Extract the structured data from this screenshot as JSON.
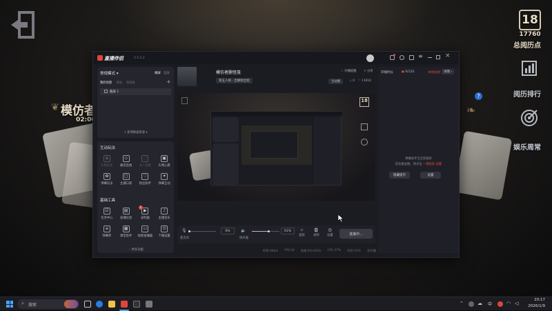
{
  "desktop": {
    "level_badge": "18",
    "points_value": "17760",
    "points_label": "总阅历点",
    "rank_label": "阅历排行",
    "weekly_label": "娱乐周常",
    "left_title": "模仿者",
    "left_timer": "02:00",
    "help_mark": "?"
  },
  "app": {
    "logo_text": "直播伴侣",
    "version": "5.5.5.2",
    "mode_label": "常规模式",
    "mode_tab_landscape": "横屏",
    "mode_tab_portrait": "竖屏",
    "scene_tabs": [
      "我的场景",
      "添加",
      "添加收"
    ],
    "scene_item": "截屏 1",
    "add_source_label": "新增数据来源",
    "interactive_title": "互动玩法",
    "interactive_items": [
      "礼物玩法",
      "嘉宾连线",
      "多人连麦",
      "礼物心愿",
      "弹幕玩法",
      "主播口袋",
      "粉丝助手",
      "弹幕互动"
    ],
    "tools_title": "基础工具",
    "tools_items": [
      "任务中心",
      "直播信息",
      "录制器",
      "主播音乐",
      "弹幕库",
      "课堂助手",
      "视频直播器",
      "下播设置"
    ],
    "tools_badge": "1",
    "more_label": "更多功能",
    "stream_title": "模仿者删怪笼",
    "category_tag": "第五人格 · 出哪款出招",
    "live_status_tag": "全站播",
    "like_count": "0",
    "viewer_count": "11916",
    "header_actions": [
      "开播提醒",
      "分享"
    ],
    "preview_badge_level": "18",
    "mic_label": "麦克风",
    "mic_value": "0%",
    "speaker_label": "扬声器",
    "speaker_value": "61%",
    "control_labels": [
      "美颜",
      "录制",
      "设置"
    ],
    "start_button": "连接中...",
    "status_bar": [
      "码率:0Kb/s",
      "FPS:30",
      "丢帧:0(0.00%)",
      "CPU:17%",
      "内存:52%",
      "未开播"
    ],
    "right_label": "开播时长",
    "right_counter": "0/120",
    "right_rank": "本场总榜",
    "right_more": "详情",
    "right_msg_1": "弹幕助手已全部推荐",
    "right_msg_2": "前往推送图，请点击 ",
    "right_msg_link": "一键粘贴",
    "right_msg_link2": "设置",
    "right_btn_1": "隐藏提示",
    "right_btn_2": "设置"
  },
  "taskbar": {
    "search_placeholder": "搜索",
    "ime_label": "中",
    "time": "20:17",
    "date": "2026/1/9"
  },
  "colors": {
    "accent_red": "#e0453a",
    "accent_blue": "#3b7bf0",
    "gold": "#e6d6b6"
  }
}
